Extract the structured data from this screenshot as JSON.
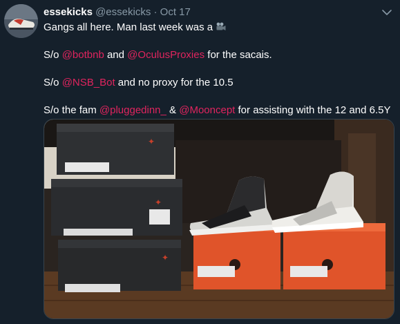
{
  "user": {
    "name": "essekicks",
    "handle": "@essekicks",
    "separator": "·",
    "timestamp": "Oct 17"
  },
  "tweet": {
    "line1": "Gangs all here. Man last week was a",
    "line2_prefix": "S/o",
    "line2_mention1": "@botbnb",
    "line2_and": "and",
    "line2_mention2": "@OculusProxies",
    "line2_suffix": "for the sacais.",
    "line3_prefix": "S/o",
    "line3_mention": "@NSB_Bot",
    "line3_suffix": "and no proxy for the 10.5",
    "line4_prefix": "S/o the fam",
    "line4_mention1": "@pluggedinn_",
    "line4_amp": "&",
    "line4_mention2": "@Mooncept",
    "line4_suffix": "for assisting with the 12 and 6.5Y"
  },
  "icons": {
    "menu": "chevron-down-icon",
    "emoji": "movie-camera-emoji"
  },
  "colors": {
    "background": "#15202b",
    "mention": "#e0245e",
    "secondary_text": "#8899a6"
  }
}
